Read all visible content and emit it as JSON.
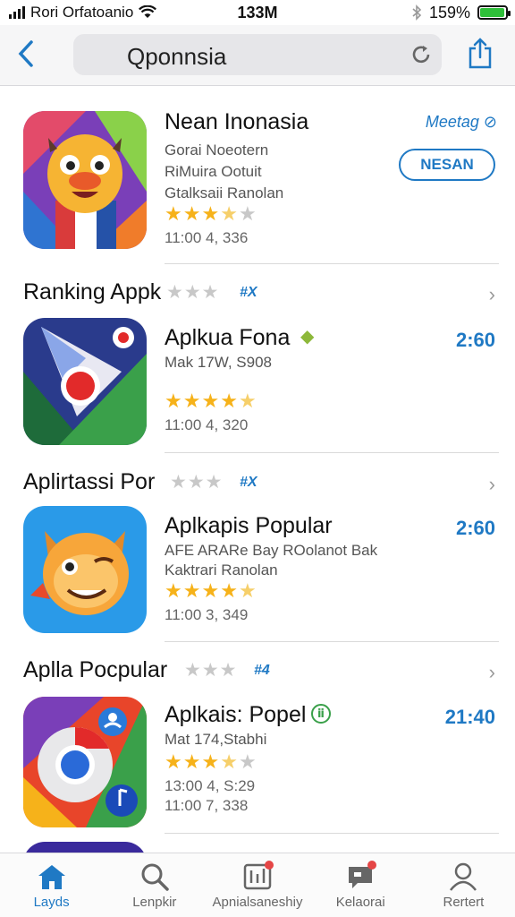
{
  "status_bar": {
    "carrier": "Rori Orfatoanio",
    "time": "133M",
    "battery_percent": "159%",
    "battery_fill": 0.95
  },
  "nav": {
    "search_text": "Qponnsia"
  },
  "featured": {
    "title": "Nean Inonasia",
    "line1": "Gorai Noeotern",
    "line2": "RiMuira Ootuit",
    "line3": "Gtalksaii Ranolan",
    "rating": 3.5,
    "meta": "11:00 4, 336",
    "link": "Meetag",
    "button": "NESAN"
  },
  "sections": [
    {
      "title": "Ranking Appk",
      "badge": "#X"
    },
    {
      "title": "Aplirtassi Por",
      "badge": "#X"
    },
    {
      "title": "Aplla Pocpular",
      "badge": "#4"
    }
  ],
  "apps": [
    {
      "title": "Aplkua Fona",
      "line1": "Mak 17W, S908",
      "rating": 4.5,
      "meta": "11:00 4, 320",
      "price": "2:60"
    },
    {
      "title": "Aplkapis Popular",
      "line1": "AFE ARARe Bay ROolanot Bak",
      "line2": "Kaktrari Ranolan",
      "rating": 4.5,
      "meta": "11:00 3, 349",
      "price": "2:60"
    },
    {
      "title": "Aplkais: Popel",
      "line1": "Mat 174,Stabhi",
      "rating": 3.5,
      "meta": "13:00 4, S:29",
      "meta2": "11:00 7, 338",
      "price": "21:40"
    }
  ],
  "tabs": [
    {
      "label": "Layds",
      "icon": "home-icon",
      "active": true
    },
    {
      "label": "Lenpkir",
      "icon": "search-icon",
      "active": false
    },
    {
      "label": "Apnialsaneshiy",
      "icon": "apps-icon",
      "active": false
    },
    {
      "label": "Kelaorai",
      "icon": "chat-icon",
      "active": false
    },
    {
      "label": "Rertert",
      "icon": "profile-icon",
      "active": false
    }
  ],
  "colors": {
    "accent": "#1f79c4",
    "star": "#f6b21a",
    "battery": "#2fbf3a",
    "badge_dot": "#e54545"
  }
}
